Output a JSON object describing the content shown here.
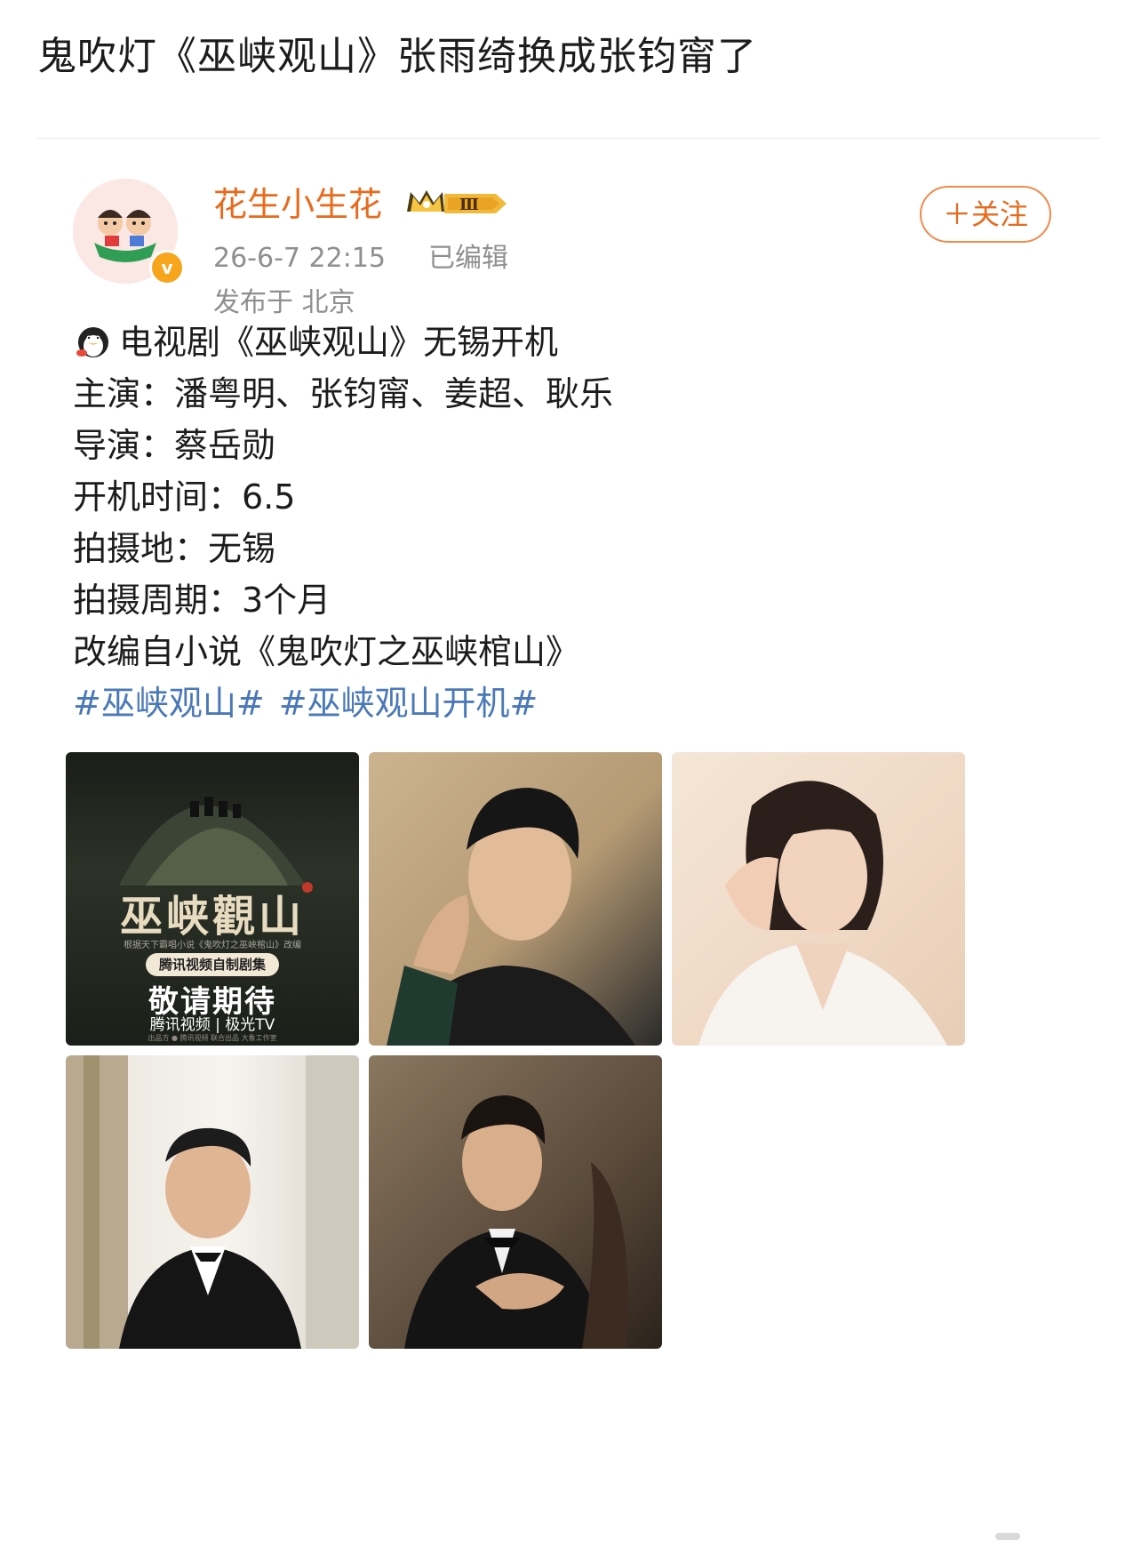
{
  "headline": "鬼吹灯《巫峡观山》张雨绮换成张钧甯了",
  "post": {
    "author": "花生小生花",
    "vip_level": "Ⅲ",
    "verified_mark": "v",
    "time": "26-6-7 22:15",
    "edited": "已编辑",
    "location": "发布于 北京",
    "follow_label": "＋关注",
    "lines": [
      "电视剧《巫峡观山》无锡开机",
      "主演：潘粤明、张钧甯、姜超、耿乐",
      "导演：蔡岳勋",
      "开机时间：6.5",
      "拍摄地：无锡",
      "拍摄周期：3个月",
      "改编自小说《鬼吹灯之巫峡棺山》"
    ],
    "hashtags": [
      "#巫峡观山#",
      "#巫峡观山开机#"
    ],
    "poster": {
      "title": "巫峡觀山",
      "small": "根据天下霸唱小说《鬼吹灯之巫峡棺山》改编",
      "pill": "腾讯视频自制剧集",
      "await": "敬请期待",
      "logos": "腾讯视频 | 极光TV",
      "footer": "出品方 ● 腾讯视频   联合出品   大象工作室"
    },
    "images": [
      "poster",
      "actor-portrait",
      "actress-portrait",
      "actor-portrait-tuxedo",
      "actor-portrait-dark"
    ]
  }
}
